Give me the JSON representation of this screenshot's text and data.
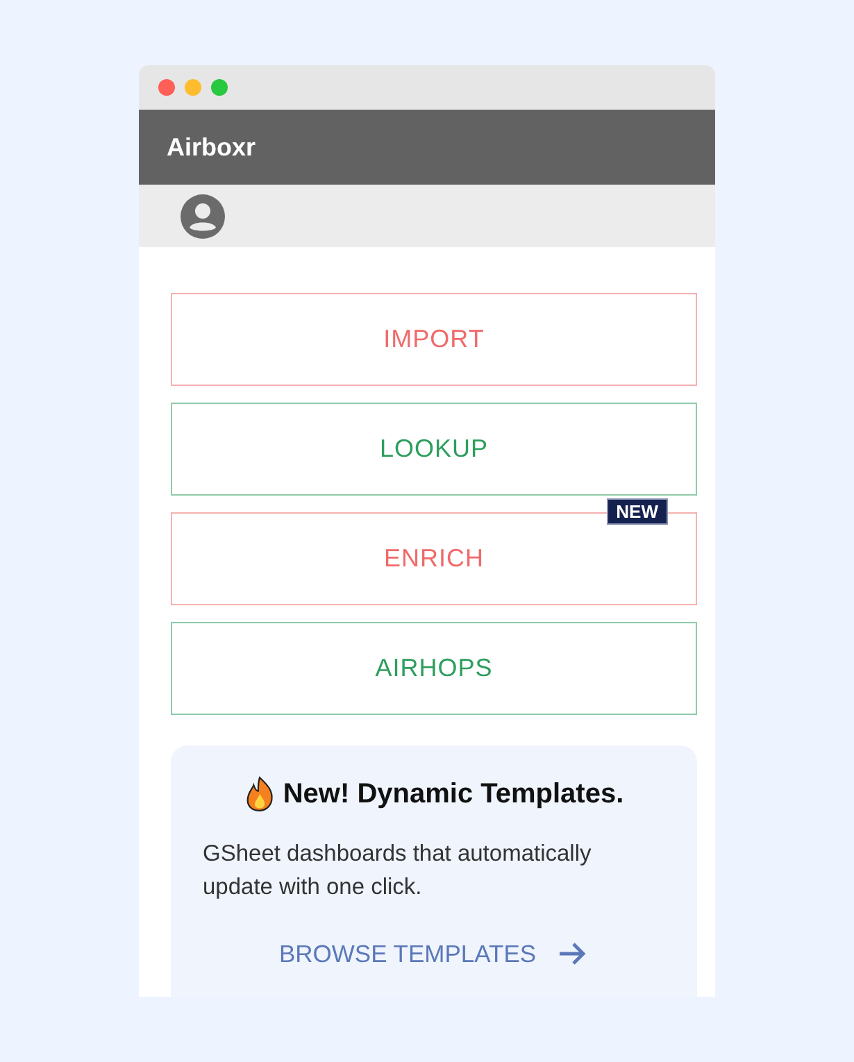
{
  "window": {
    "title": "Airboxr"
  },
  "actions": [
    {
      "label": "IMPORT",
      "color": "#f06a6a"
    },
    {
      "label": "LOOKUP",
      "color": "#2e9e5e"
    },
    {
      "label": "ENRICH",
      "color": "#f06a6a",
      "badge": "NEW"
    },
    {
      "label": "AIRHOPS",
      "color": "#2e9e5e"
    }
  ],
  "promo": {
    "title": "New! Dynamic Templates.",
    "text": "GSheet dashboards that automatically update with one click.",
    "link": "BROWSE TEMPLATES"
  }
}
